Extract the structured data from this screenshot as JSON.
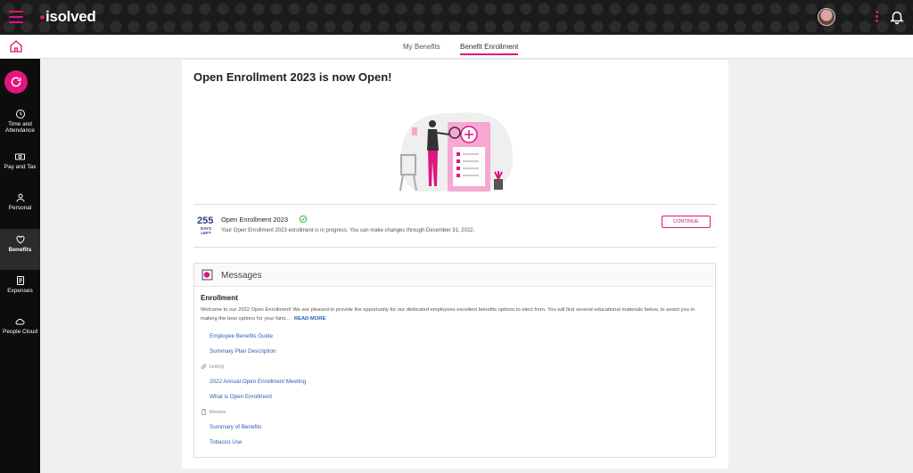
{
  "brand": {
    "logo_text": "isolved",
    "accent_color": "#e0157f"
  },
  "subnav": {
    "tabs": [
      {
        "label": "My Benefits",
        "active": false
      },
      {
        "label": "Benefit Enrollment",
        "active": true
      }
    ]
  },
  "sidebar": {
    "items": [
      {
        "label_1": "Time and",
        "label_2": "Attendance",
        "icon": "clock-icon"
      },
      {
        "label": "Pay and Tax",
        "icon": "money-icon"
      },
      {
        "label": "Personal",
        "icon": "person-icon"
      },
      {
        "label": "Benefits",
        "icon": "heart-icon",
        "active": true
      },
      {
        "label": "Expenses",
        "icon": "receipt-icon"
      },
      {
        "label": "People Cloud",
        "icon": "cloud-icon"
      }
    ]
  },
  "main": {
    "title": "Open Enrollment 2023 is now Open!",
    "enrollment": {
      "days_count": "255",
      "days_label_1": "DAYS",
      "days_label_2": "LEFT",
      "name": "Open Enrollment 2023",
      "description": "Your Open Enrollment 2023 enrollment is in progress. You can make changes through December 31, 2022.",
      "continue_label": "CONTINUE"
    },
    "messages": {
      "header": "Messages",
      "section_title": "Enrollment",
      "body": "Welcome to our 2022 Open Enrollment! We are pleased to provide the opportunity for our dedicated employees excellent benefits options to elect from. You will find several educational materials below, to assist you in making the best options for your fami...",
      "read_more": "READ MORE",
      "links_group_1": [
        "Employee Benefits Guide",
        "Summary Plan Description"
      ],
      "links_label": "Link(s)",
      "links_group_2": [
        "2022 Annual Open Enrollment Meeting",
        "What is Open Enrollment"
      ],
      "review_label": "Review",
      "links_group_3": [
        "Summary of Benefits",
        "Tobacco Use"
      ]
    }
  }
}
